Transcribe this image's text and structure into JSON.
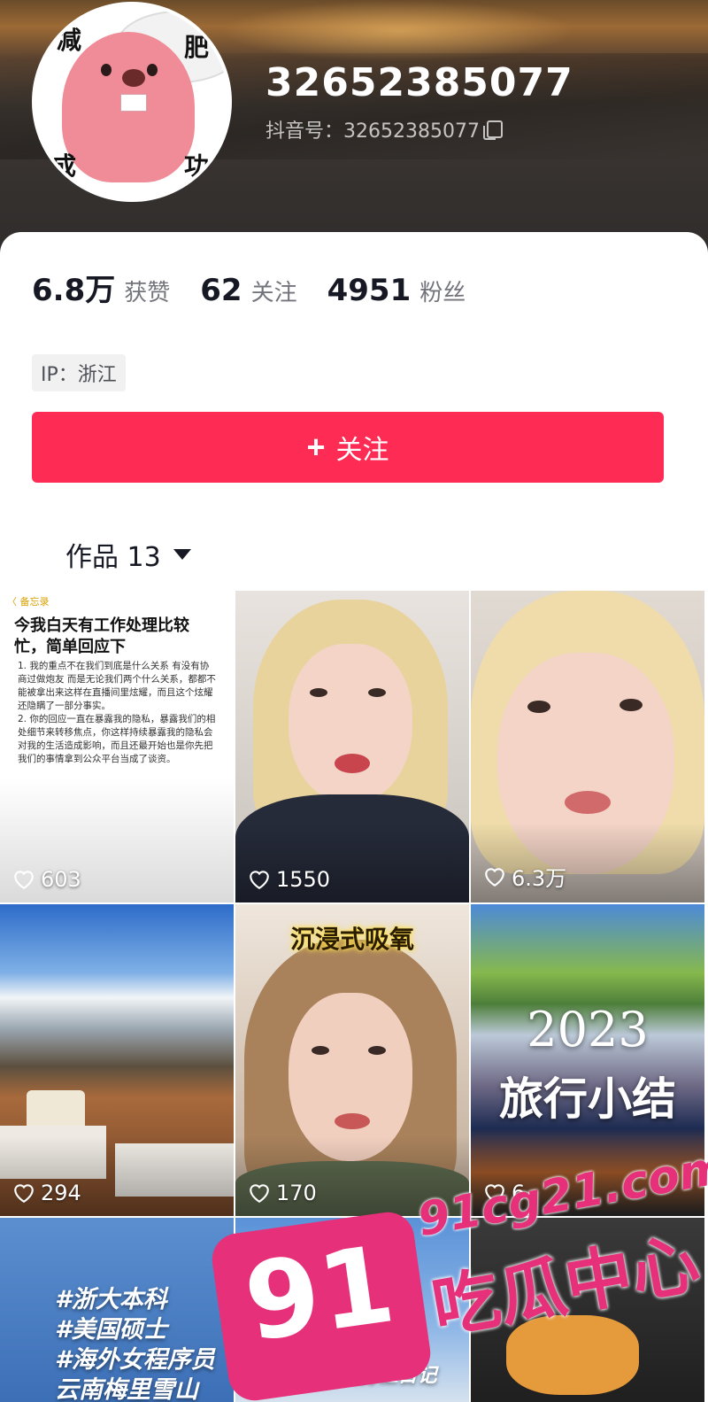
{
  "profile": {
    "username": "32652385077",
    "douyin_id_label": "抖音号：32652385077",
    "avatar_text": [
      "减",
      "肥",
      "成",
      "功"
    ]
  },
  "stats": [
    {
      "value": "6.8万",
      "label": "获赞"
    },
    {
      "value": "62",
      "label": "关注"
    },
    {
      "value": "4951",
      "label": "粉丝"
    }
  ],
  "ip_tag": "IP：浙江",
  "follow_button": {
    "label": "关注"
  },
  "works_tab": {
    "label": "作品 13"
  },
  "notes_tile": {
    "nav": "〈 备忘录",
    "title": "今我白天有工作处理比较忙，简单回应下",
    "body": "1. 我的重点不在我们到底是什么关系 有没有协商过做炮友 而是无论我们两个什么关系，都都不能被拿出来这样在直播间里炫耀，而且这个炫耀还隐瞒了一部分事实。\n2. 你的回应一直在暴露我的隐私，暴露我们的相处细节来转移焦点，你这样持续暴露我的隐私会对我的生活造成影响，而且还最开始也是你先把我们的事情拿到公众平台当成了谈资。"
  },
  "tiles": [
    {
      "likes": "603"
    },
    {
      "likes": "1550"
    },
    {
      "likes": "6.3万"
    },
    {
      "likes": "294"
    },
    {
      "likes": "170",
      "caption": "沉浸式吸氧"
    },
    {
      "likes": "6",
      "year": "2023",
      "title": "旅行小结"
    },
    {
      "tags": [
        "#浙大本科",
        "#美国硕士",
        "#海外女程序员",
        "云南梅里雪山"
      ]
    },
    {
      "caption": "#梅里雪山打工日记"
    },
    {}
  ],
  "watermark": {
    "site": "91cg21.com",
    "badge": "91",
    "name": "吃瓜中心"
  },
  "colors": {
    "accent": "#fe2c55",
    "text": "#161823"
  }
}
